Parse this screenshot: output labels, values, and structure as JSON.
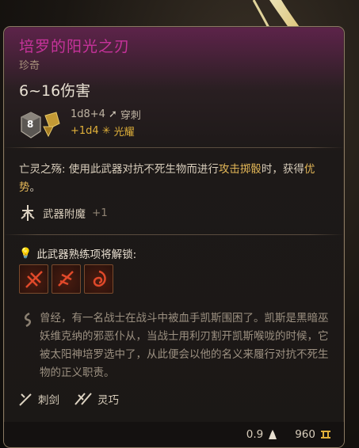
{
  "item": {
    "name": "培罗的阳光之刃",
    "rarity": "珍奇",
    "damage": "6~16伤害",
    "die_label": "8",
    "dice": "1d8+4",
    "damage_type": "穿刺",
    "bonus_dice": "+1d4",
    "bonus_type": "光耀"
  },
  "passive": {
    "name": "亡灵之殇",
    "text_a": ": 使用此武器对抗不死生物而进行",
    "link_a": "攻击掷骰",
    "text_b": "时，获得",
    "link_b": "优势",
    "text_c": "。"
  },
  "enchant": {
    "label": "武器附魔",
    "value": "+1"
  },
  "proficiency": {
    "title": "此武器熟练项将解锁:",
    "skills": [
      "skill-1",
      "skill-2",
      "skill-3"
    ]
  },
  "lore": "曾经，有一名战士在战斗中被血手凯斯围困了。凯斯是黑暗巫妖维克纳的邪恶仆从，当战士用利刃割开凯斯喉咙的时候，它被太阳神培罗选中了，从此便会以他的名义来履行对抗不死生物的正义职责。",
  "properties": [
    {
      "label": "刺剑",
      "icon": "rapier-icon"
    },
    {
      "label": "灵巧",
      "icon": "finesse-icon"
    }
  ],
  "footer": {
    "weight": "0.9",
    "value": "960"
  },
  "colors": {
    "title": "#c7339b",
    "highlight": "#e2b657",
    "bonus": "#e1b13a"
  }
}
